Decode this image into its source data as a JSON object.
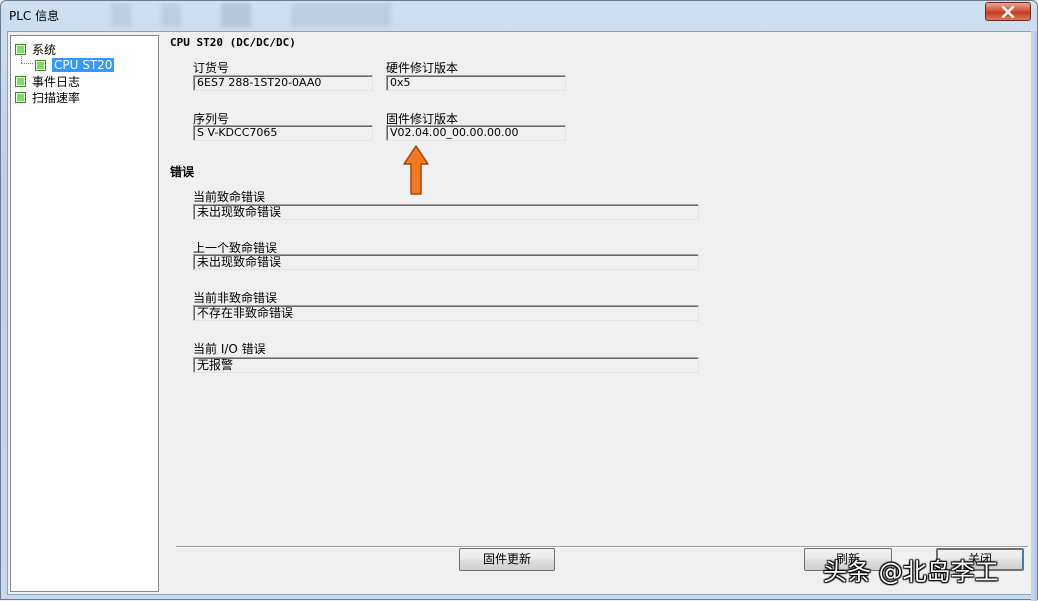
{
  "window": {
    "title": "PLC 信息"
  },
  "tree": {
    "items": [
      {
        "label": "系统",
        "level": 0
      },
      {
        "label": "CPU ST20",
        "level": 1,
        "selected": true
      },
      {
        "label": "事件日志",
        "level": 0
      },
      {
        "label": "扫描速率",
        "level": 0
      }
    ]
  },
  "cpu": {
    "title": "CPU ST20  (DC/DC/DC)",
    "order_label": "订货号",
    "order_value": "6ES7 288-1ST20-0AA0",
    "hw_label": "硬件修订版本",
    "hw_value": "0x5",
    "serial_label": "序列号",
    "serial_value": "S V-KDCC7065",
    "fw_label": "固件修订版本",
    "fw_value": "V02.04.00_00.00.00.00"
  },
  "errors": {
    "title": "错误",
    "fatal_current_label": "当前致命错误",
    "fatal_current_value": "未出现致命错误",
    "fatal_last_label": "上一个致命错误",
    "fatal_last_value": "未出现致命错误",
    "nonfatal_label": "当前非致命错误",
    "nonfatal_value": "不存在非致命错误",
    "io_label": "当前 I/O 错误",
    "io_value": "无报警"
  },
  "buttons": {
    "firmware_update": "固件更新",
    "refresh": "刷新",
    "close": "关闭"
  },
  "watermark": "头条 @北岛李工",
  "colors": {
    "accent_arrow": "#f47a20",
    "selection": "#3399ff",
    "close_red": "#c13f23"
  }
}
